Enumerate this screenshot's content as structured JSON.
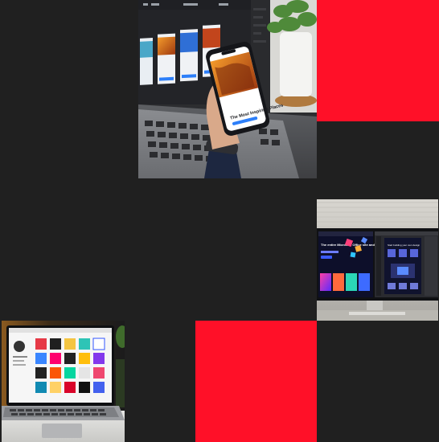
{
  "colors": {
    "background": "#202020",
    "accent_red": "#ff1028"
  },
  "tiles": [
    {
      "name": "photo-laptop-phone-design",
      "kind": "photo"
    },
    {
      "name": "red-block-top-right",
      "kind": "color"
    },
    {
      "name": "photo-dual-monitor-design",
      "kind": "photo"
    },
    {
      "name": "photo-laptop-gallery-grid",
      "kind": "photo"
    },
    {
      "name": "red-block-bottom-center",
      "kind": "color"
    }
  ],
  "photo_text": {
    "phone_headline": "The Most Inspiring Places",
    "monitor_headline": "The entire Microsoft Office site and more are yours",
    "monitor_right_title": "Start building your own design"
  }
}
